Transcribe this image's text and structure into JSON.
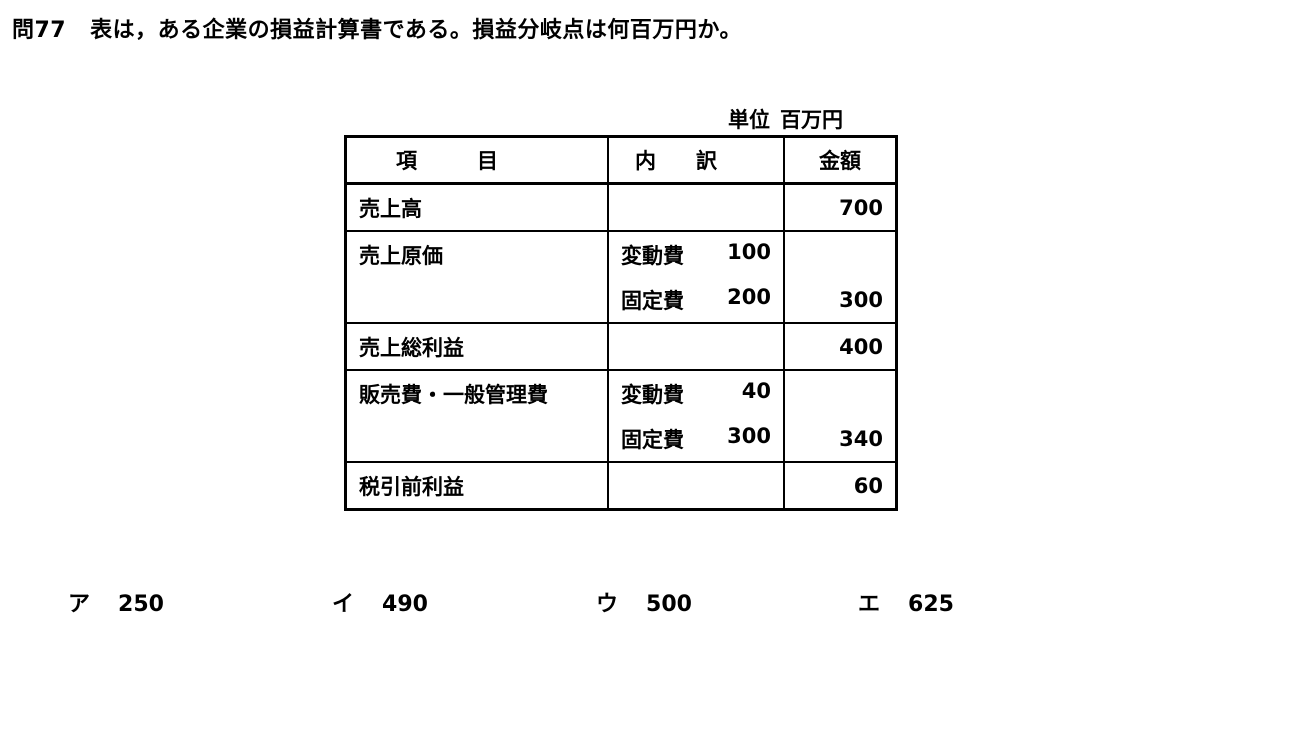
{
  "question": {
    "number": "問77",
    "text": "表は，ある企業の損益計算書である。損益分岐点は何百万円か。"
  },
  "unit": {
    "label": "単位",
    "value": "百万円"
  },
  "table": {
    "headers": [
      "項目",
      "内訳",
      "金額"
    ],
    "rows": [
      {
        "item": "売上高",
        "breakdown_label": "",
        "breakdown_value": "",
        "amount": "700"
      },
      {
        "item": "売上原価",
        "breakdown_label": "変動費",
        "breakdown_value": "100",
        "amount": ""
      },
      {
        "item": "",
        "breakdown_label": "固定費",
        "breakdown_value": "200",
        "amount": "300"
      },
      {
        "item": "売上総利益",
        "breakdown_label": "",
        "breakdown_value": "",
        "amount": "400"
      },
      {
        "item": "販売費・一般管理費",
        "breakdown_label": "変動費",
        "breakdown_value": "40",
        "amount": ""
      },
      {
        "item": "",
        "breakdown_label": "固定費",
        "breakdown_value": "300",
        "amount": "340"
      },
      {
        "item": "税引前利益",
        "breakdown_label": "",
        "breakdown_value": "",
        "amount": "60"
      }
    ]
  },
  "choices": [
    {
      "key": "ア",
      "value": "250"
    },
    {
      "key": "イ",
      "value": "490"
    },
    {
      "key": "ウ",
      "value": "500"
    },
    {
      "key": "エ",
      "value": "625"
    }
  ]
}
